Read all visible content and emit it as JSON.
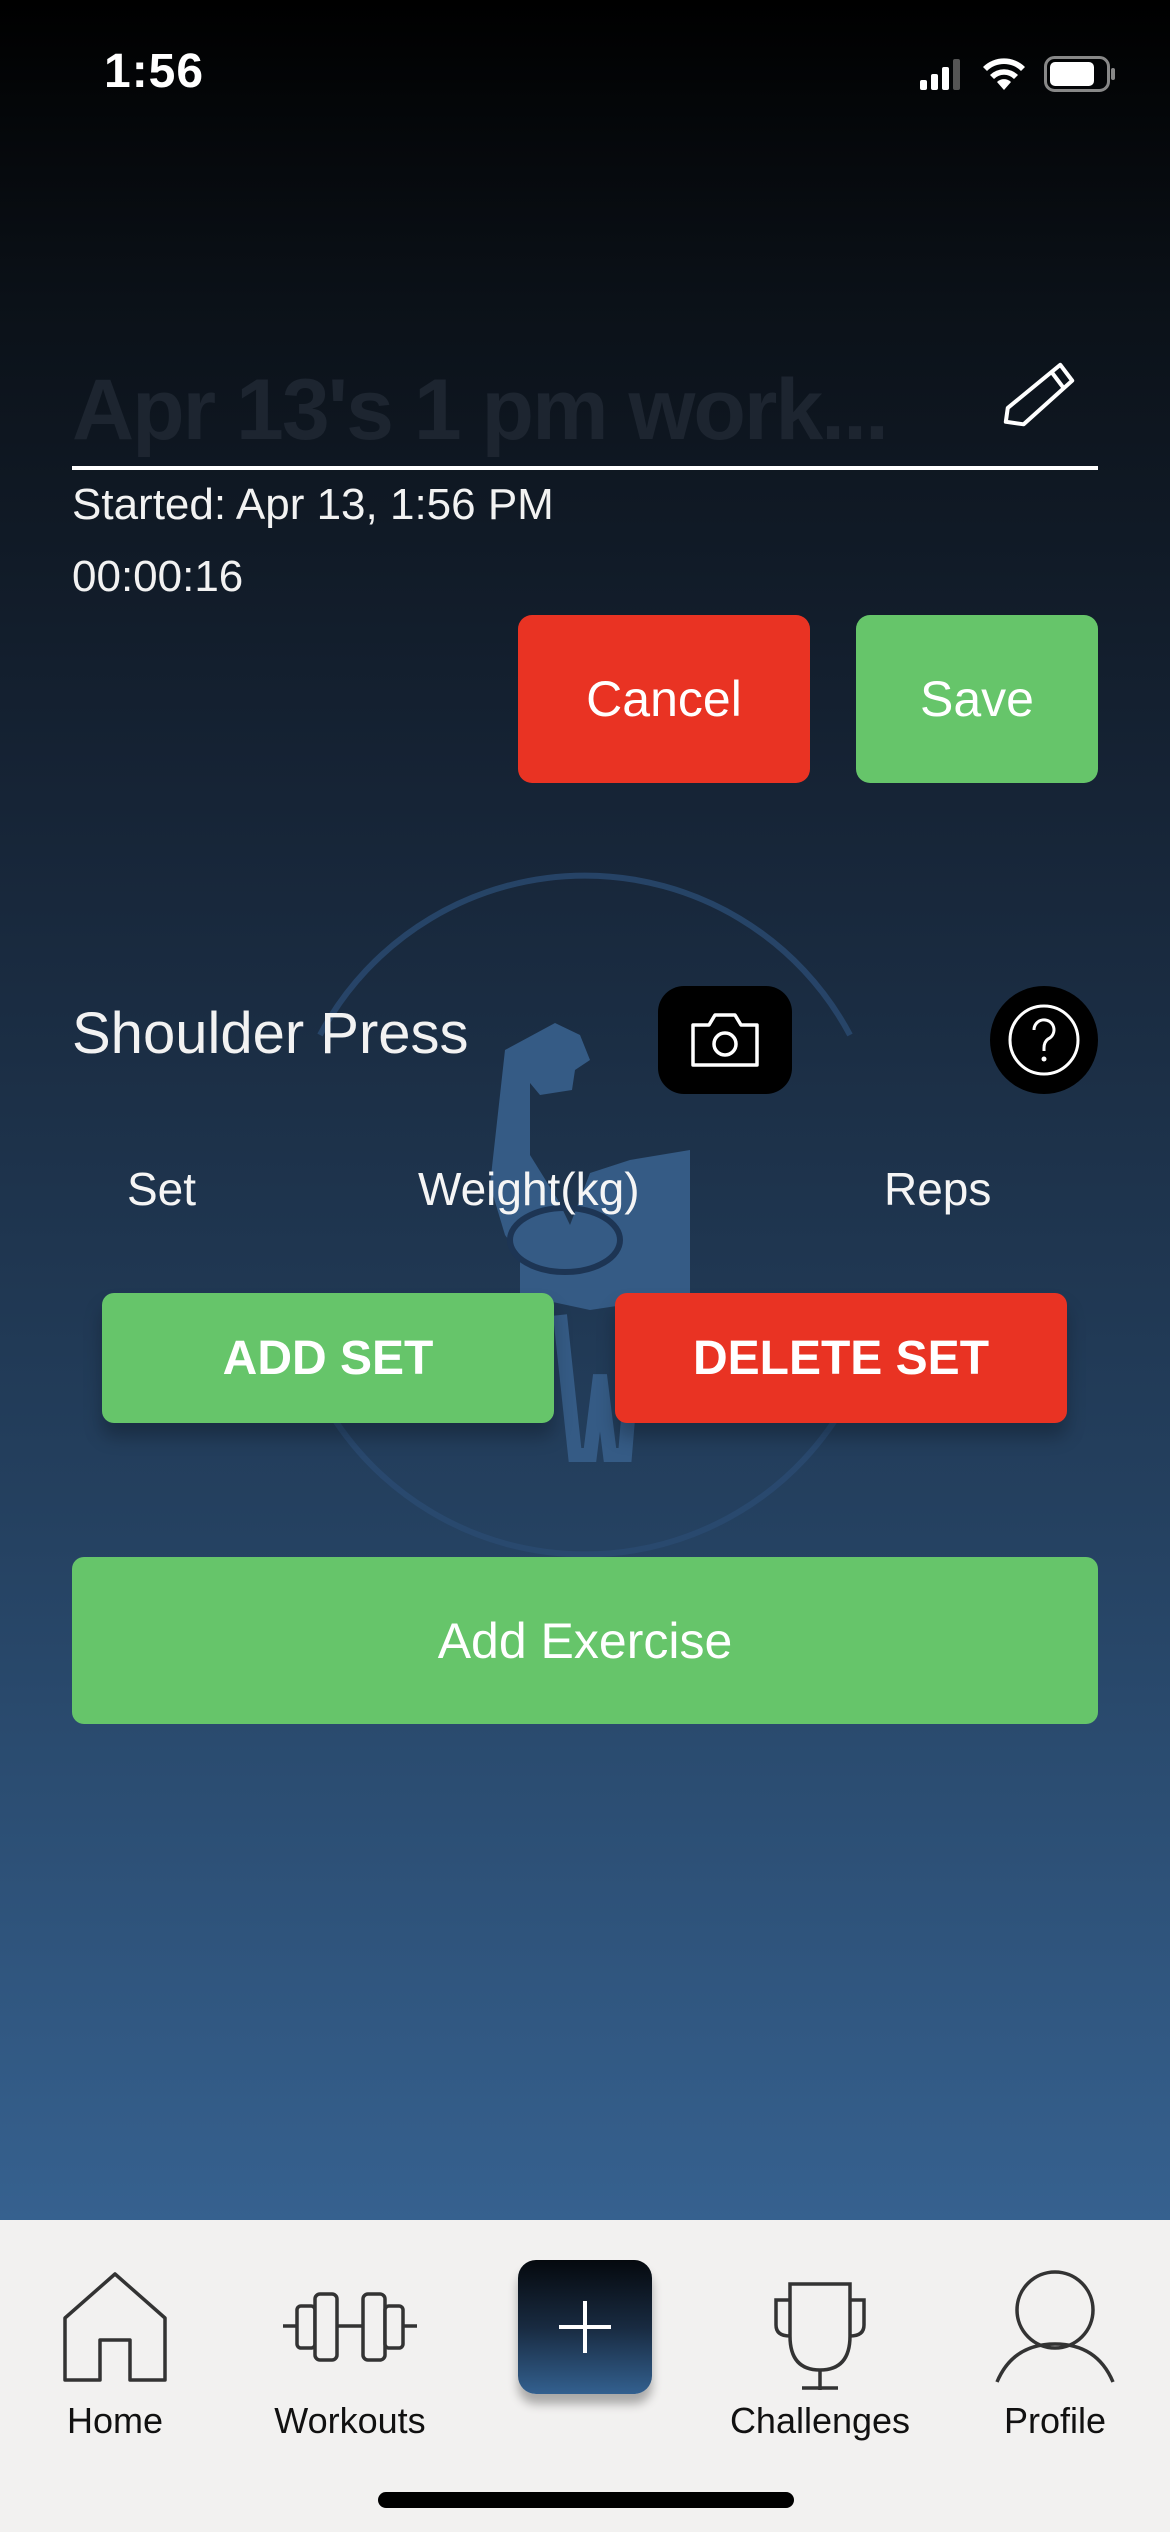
{
  "status_bar": {
    "time": "1:56",
    "icons": [
      "cellular-signal-icon",
      "wifi-icon",
      "battery-icon"
    ]
  },
  "workout": {
    "title_placeholder": "Apr 13's 1 pm work...",
    "title_value": "",
    "edit_icon": "pencil-icon",
    "started": "Started: Apr 13, 1:56 PM",
    "elapsed": "00:00:16"
  },
  "actions": {
    "cancel_label": "Cancel",
    "save_label": "Save"
  },
  "exercise": {
    "name": "Shoulder Press",
    "camera_icon": "camera-icon",
    "help_icon": "question-mark-icon",
    "columns": [
      "Set",
      "Weight(kg)",
      "Reps"
    ],
    "add_set_label": "ADD SET",
    "delete_set_label": "DELETE SET"
  },
  "add_exercise_label": "Add Exercise",
  "colors": {
    "accent_green": "#66c56a",
    "accent_red": "#e93323",
    "tabbar_bg": "#f2f1f0"
  },
  "tabbar": {
    "items": [
      {
        "label": "Home",
        "icon": "home-icon"
      },
      {
        "label": "Workouts",
        "icon": "dumbbell-icon"
      },
      {
        "label": "",
        "icon": "plus-icon"
      },
      {
        "label": "Challenges",
        "icon": "trophy-icon"
      },
      {
        "label": "Profile",
        "icon": "person-icon"
      }
    ]
  }
}
